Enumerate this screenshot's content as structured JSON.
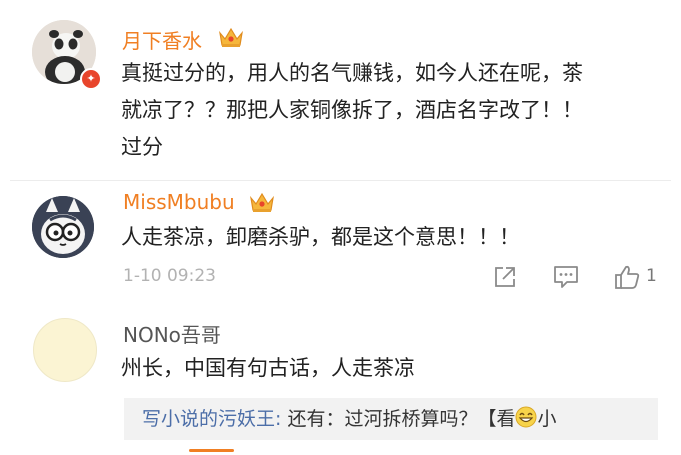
{
  "comments": [
    {
      "username": "月下香水",
      "text_lines": [
        "真挺过分的，用人的名气赚钱，如今人还在呢，茶",
        "就凉了？？那把人家铜像拆了，酒店名字改了！！",
        "过分"
      ]
    },
    {
      "username": "MissMbubu",
      "text": "人走茶凉，卸磨杀驴，都是这个意思！！！",
      "timestamp": "1-10 09:23",
      "like_count": "1"
    },
    {
      "username": "NONo吾哥",
      "text": "州长，中国有句古话，人走茶凉",
      "reply": {
        "author": "写小说的污妖王:",
        "text_before": "还有：过河拆桥算吗？【看",
        "text_after": "小"
      }
    }
  ],
  "colors": {
    "username_orange": "#f07f23",
    "reply_name_blue": "#4c6ea8",
    "meta_grey": "#b2b2b2"
  },
  "icons": [
    "crown-icon",
    "v-badge-icon",
    "share-icon",
    "comment-icon",
    "like-icon",
    "smile-emoji-icon"
  ]
}
